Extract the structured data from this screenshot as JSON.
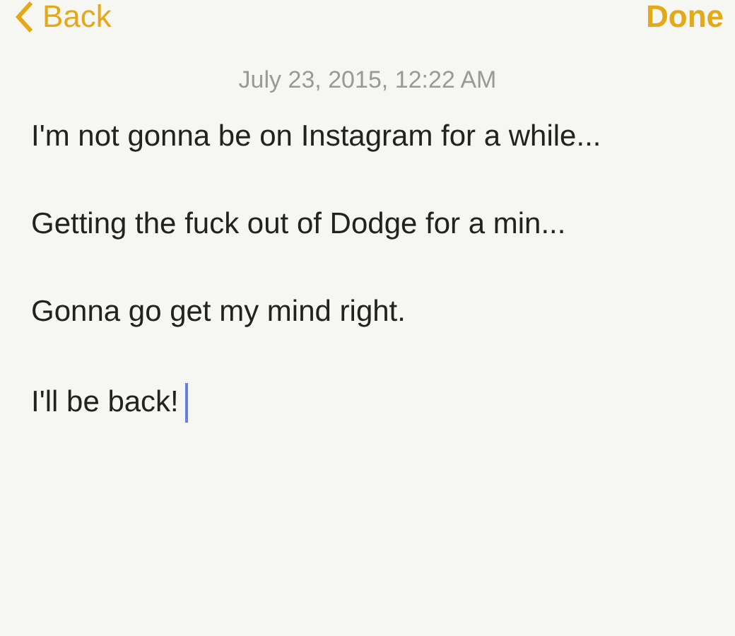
{
  "nav": {
    "back": "Back",
    "done": "Done"
  },
  "date": "July 23, 2015, 12:22 AM",
  "lines": [
    "I'm not gonna be on Instagram for a while...",
    "Getting the fuck out of Dodge for a min...",
    "Gonna go get my mind right.",
    "I'll be back!"
  ]
}
